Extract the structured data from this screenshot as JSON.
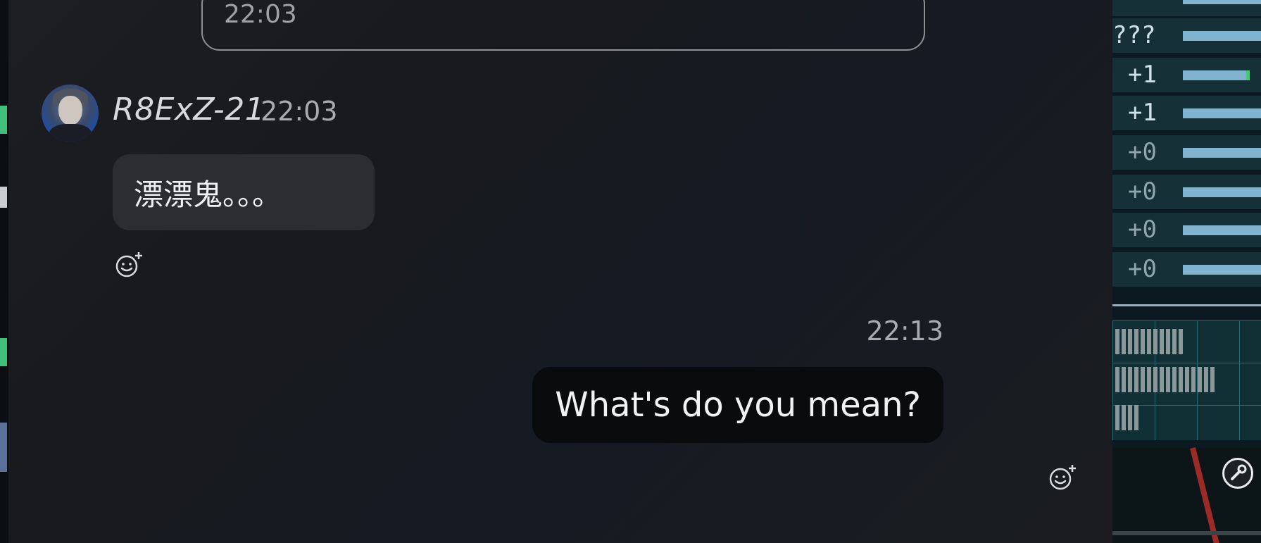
{
  "chat": {
    "previous_message": {
      "time": "22:03"
    },
    "incoming": {
      "username": "R8ExZ-21",
      "time": "22:03",
      "text": "漂漂鬼。。。",
      "avatar_icon": "avatar-icon",
      "react_icon": "add-reaction-icon"
    },
    "outgoing": {
      "time": "22:13",
      "text": "What's do you mean?",
      "react_icon": "add-reaction-icon"
    }
  },
  "game_hud": {
    "rows": [
      {
        "value": "???"
      },
      {
        "value": "+1"
      },
      {
        "value": "+1"
      },
      {
        "value": "+0"
      },
      {
        "value": "+0"
      },
      {
        "value": "+0"
      },
      {
        "value": "+0"
      }
    ],
    "tool_icon": "wrench-icon"
  },
  "colors": {
    "incoming_bubble": "#2b2d31",
    "outgoing_bubble": "#0a0b0d",
    "hud_bar": "#7fb3cf",
    "hud_accent": "#46c77a"
  }
}
